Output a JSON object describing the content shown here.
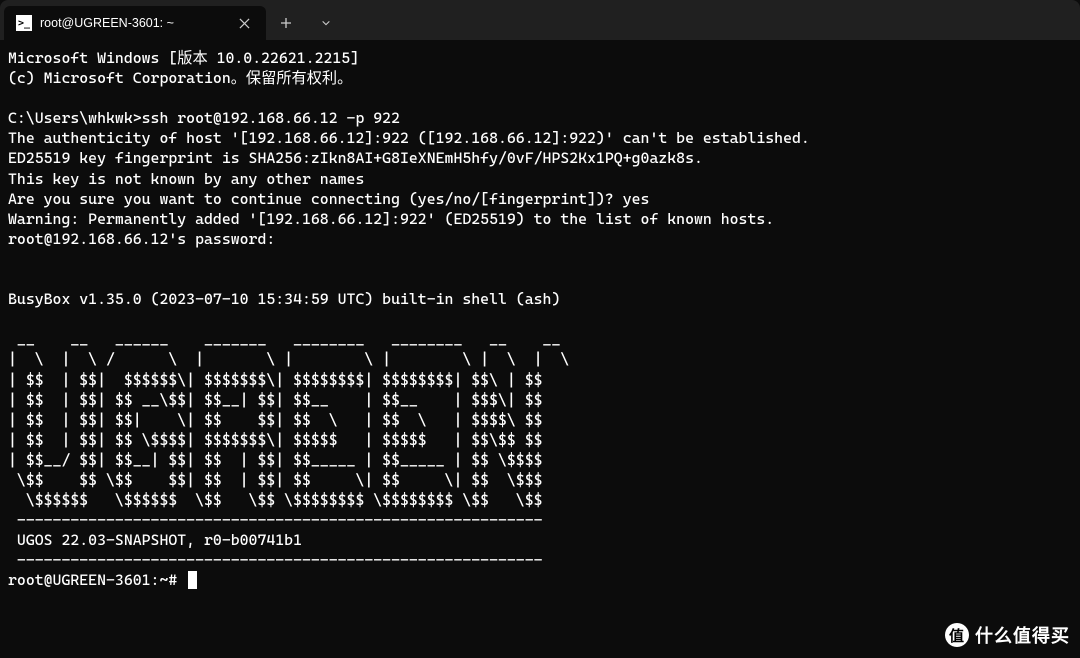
{
  "tab": {
    "title": "root@UGREEN-3601: ~",
    "icon_glyph": ">_"
  },
  "terminal": {
    "lines": [
      "Microsoft Windows [版本 10.0.22621.2215]",
      "(c) Microsoft Corporation。保留所有权利。",
      "",
      "C:\\Users\\whkwk>ssh root@192.168.66.12 -p 922",
      "The authenticity of host '[192.168.66.12]:922 ([192.168.66.12]:922)' can't be established.",
      "ED25519 key fingerprint is SHA256:zIkn8AI+G8IeXNEmH5hfy/0vF/HPS2Kx1PQ+g0azk8s.",
      "This key is not known by any other names",
      "Are you sure you want to continue connecting (yes/no/[fingerprint])? yes",
      "Warning: Permanently added '[192.168.66.12]:922' (ED25519) to the list of known hosts.",
      "root@192.168.66.12's password:",
      "",
      "",
      "BusyBox v1.35.0 (2023-07-10 15:34:59 UTC) built-in shell (ash)",
      "",
      " __    __   ______    _______   ________   ________   __    __",
      "|  \\  |  \\ /      \\  |       \\ |        \\ |        \\ |  \\  |  \\",
      "| $$  | $$|  $$$$$$\\| $$$$$$$\\| $$$$$$$$| $$$$$$$$| $$\\ | $$",
      "| $$  | $$| $$ __\\$$| $$__| $$| $$__    | $$__    | $$$\\| $$",
      "| $$  | $$| $$|    \\| $$    $$| $$  \\   | $$  \\   | $$$$\\ $$",
      "| $$  | $$| $$ \\$$$$| $$$$$$$\\| $$$$$   | $$$$$   | $$\\$$ $$",
      "| $$__/ $$| $$__| $$| $$  | $$| $$_____ | $$_____ | $$ \\$$$$",
      " \\$$    $$ \\$$    $$| $$  | $$| $$     \\| $$     \\| $$  \\$$$",
      "  \\$$$$$$   \\$$$$$$  \\$$   \\$$ \\$$$$$$$$ \\$$$$$$$$ \\$$   \\$$",
      " -----------------------------------------------------------",
      " UGOS 22.03-SNAPSHOT, r0-b00741b1",
      " -----------------------------------------------------------"
    ],
    "prompt": "root@UGREEN-3601:~# "
  },
  "watermark": {
    "badge": "值",
    "text": "什么值得买"
  }
}
